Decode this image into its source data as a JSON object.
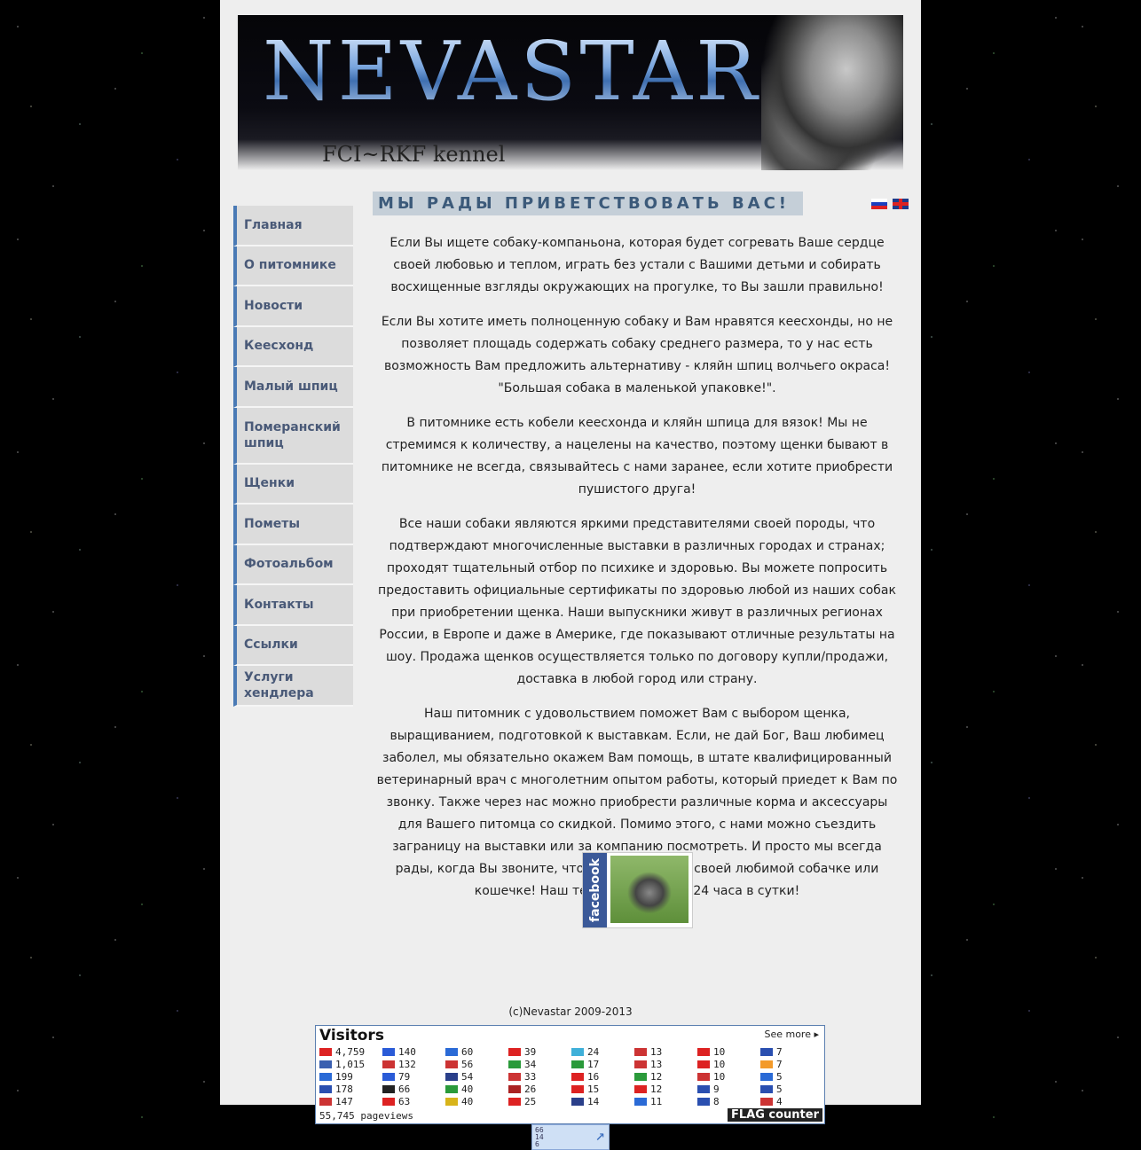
{
  "banner": {
    "title": "NEVASTAR",
    "subtitle": "FCI~RKF kennel"
  },
  "greeting": "МЫ РАДЫ ПРИВЕТСТВОВАТЬ ВАС!",
  "nav": [
    "Главная",
    "О питомнике",
    "Новости",
    "Кеесхонд",
    "Малый шпиц",
    "Померанский шпиц",
    "Щенки",
    "Пометы",
    "Фотоальбом",
    "Контакты",
    "Ссылки",
    "Услуги хендлера"
  ],
  "paragraphs": [
    "Если Вы ищете собаку-компаньона, которая будет согревать Ваше сердце своей любовью и теплом, играть без устали с Вашими детьми и собирать восхищенные взгляды окружающих на прогулке, то Вы зашли правильно!",
    "Если Вы хотите иметь полноценную собаку и Вам нравятся кеесхонды, но не позволяет площадь содержать собаку среднего размера, то у нас есть возможность Вам предложить альтернативу - кляйн шпиц волчьего окраса! \"Большая собака в маленькой упаковке!\".",
    "В питомнике есть кобели кеесхонда и кляйн шпица для вязок! Мы не стремимся к количеству, а нацелены на качество, поэтому щенки бывают в питомнике не всегда, связывайтесь с нами заранее, если хотите приобрести пушистого друга!",
    "Все наши собаки являются яркими представителями своей породы, что подтверждают многочисленные выставки в различных городах и странах; проходят тщательный отбор по психике и здоровью. Вы можете попросить предоставить официальные сертификаты по здоровью любой из наших собак при приобретении щенка. Наши выпускники живут в различных регионах России, в Европе и даже в Америке, где показывают отличные результаты на шоу. Продажа щенков осуществляется только по договору купли/продажи, доставка в любой город или страну.",
    "Наш питомник с удовольствием поможет Вам с выбором щенка, выращиванием, подготовкой к выставкам. Если, не дай Бог, Ваш любимец заболел, мы обязательно окажем Вам помощь, в штате квалифицированный ветеринарный врач с многолетним опытом работы, который приедет к Вам по звонку. Также через нас можно приобрести различные корма и аксессуары для Вашего питомца со скидкой. Помимо этого, с нами можно съездить заграницу на выставки или за компанию посмотреть. И просто мы всегда рады, когда Вы звоните, чтобы рассказать о своей любимой собачке или кошечке! Наш телефон включен 24 часа в сутки!"
  ],
  "facebook_label": "facebook",
  "copyright": "(c)Nevastar 2009-2013",
  "counter": {
    "title": "Visitors",
    "see_more": "See more ▸",
    "pageviews": "55,745 pageviews",
    "logo": "FLAG counter",
    "entries": [
      {
        "v": "4,759",
        "c": "#d22"
      },
      {
        "v": "140",
        "c": "#2a5bd7"
      },
      {
        "v": "60",
        "c": "#2a6ad6"
      },
      {
        "v": "39",
        "c": "#d22"
      },
      {
        "v": "24",
        "c": "#3fb0d9"
      },
      {
        "v": "13",
        "c": "#c33"
      },
      {
        "v": "10",
        "c": "#d22"
      },
      {
        "v": "7",
        "c": "#2a4fb0"
      },
      {
        "v": "1,015",
        "c": "#3a5fb0"
      },
      {
        "v": "132",
        "c": "#c33"
      },
      {
        "v": "56",
        "c": "#c33"
      },
      {
        "v": "34",
        "c": "#2a9a3a"
      },
      {
        "v": "17",
        "c": "#2a9a3a"
      },
      {
        "v": "13",
        "c": "#c33"
      },
      {
        "v": "10",
        "c": "#d22"
      },
      {
        "v": "7",
        "c": "#f39a2a"
      },
      {
        "v": "199",
        "c": "#2a6ad6"
      },
      {
        "v": "79",
        "c": "#2a5bd7"
      },
      {
        "v": "54",
        "c": "#2a3f8a"
      },
      {
        "v": "33",
        "c": "#c33"
      },
      {
        "v": "16",
        "c": "#d22"
      },
      {
        "v": "12",
        "c": "#2a9a3a"
      },
      {
        "v": "10",
        "c": "#c33"
      },
      {
        "v": "5",
        "c": "#2a6ad6"
      },
      {
        "v": "178",
        "c": "#2a4fb0"
      },
      {
        "v": "66",
        "c": "#222"
      },
      {
        "v": "40",
        "c": "#2a9a3a"
      },
      {
        "v": "26",
        "c": "#a22"
      },
      {
        "v": "15",
        "c": "#d22"
      },
      {
        "v": "12",
        "c": "#d22"
      },
      {
        "v": "9",
        "c": "#2a4fb0"
      },
      {
        "v": "5",
        "c": "#2a4fb0"
      },
      {
        "v": "147",
        "c": "#c33"
      },
      {
        "v": "63",
        "c": "#d22"
      },
      {
        "v": "40",
        "c": "#d8b41a"
      },
      {
        "v": "25",
        "c": "#d22"
      },
      {
        "v": "14",
        "c": "#2a3f8a"
      },
      {
        "v": "11",
        "c": "#2a6ad6"
      },
      {
        "v": "8",
        "c": "#2a4fb0"
      },
      {
        "v": "4",
        "c": "#c33"
      }
    ]
  },
  "mini_counter": {
    "lines": [
      "66",
      "14",
      "6"
    ]
  }
}
